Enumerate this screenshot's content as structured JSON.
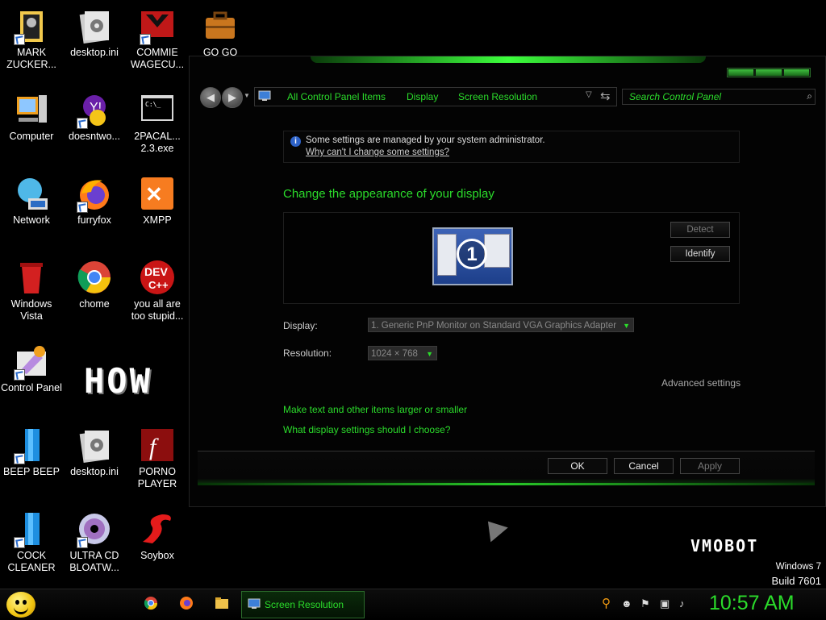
{
  "desktop": {
    "icons": [
      {
        "id": "mark",
        "label": "MARK ZUCKER..."
      },
      {
        "id": "desktopini1",
        "label": "desktop.ini"
      },
      {
        "id": "commie",
        "label": "COMMIE WAGECU..."
      },
      {
        "id": "gogo",
        "label": "GO GO"
      },
      {
        "id": "computer",
        "label": "Computer"
      },
      {
        "id": "doesnt",
        "label": "doesntwo..."
      },
      {
        "id": "pacal",
        "label": "2PACAL... 2.3.exe"
      },
      {
        "id": "network",
        "label": "Network"
      },
      {
        "id": "furryfox",
        "label": "furryfox"
      },
      {
        "id": "xmpp",
        "label": "XMPP"
      },
      {
        "id": "vista",
        "label": "Windows Vista"
      },
      {
        "id": "chome",
        "label": "chome"
      },
      {
        "id": "devcpp",
        "label": "you all are too stupid..."
      },
      {
        "id": "cpanel",
        "label": "Control Panel"
      },
      {
        "id": "beep",
        "label": "BEEP BEEP"
      },
      {
        "id": "desktopini2",
        "label": "desktop.ini"
      },
      {
        "id": "porno",
        "label": "PORNO PLAYER"
      },
      {
        "id": "cock",
        "label": "COCK CLEANER"
      },
      {
        "id": "ultracd",
        "label": "ULTRA CD BLOATW..."
      },
      {
        "id": "soybox",
        "label": "Soybox"
      }
    ],
    "how_text": "HOW",
    "vmobot_text": "VMOBOT",
    "windows_version": "Windows 7",
    "build": "Build 7601"
  },
  "window": {
    "breadcrumb": [
      "All Control Panel Items",
      "Display",
      "Screen Resolution"
    ],
    "search_placeholder": "Search Control Panel",
    "info_line1": "Some settings are managed by your system administrator.",
    "info_link": "Why can't I change some settings?",
    "heading": "Change the appearance of your display",
    "monitor_number": "1",
    "detect_label": "Detect",
    "identify_label": "Identify",
    "display_label": "Display:",
    "display_value": "1. Generic PnP Monitor on Standard VGA Graphics Adapter",
    "resolution_label": "Resolution:",
    "resolution_value": "1024 × 768",
    "advanced_label": "Advanced settings",
    "link1": "Make text and other items larger or smaller",
    "link2": "What display settings should I choose?",
    "ok_label": "OK",
    "cancel_label": "Cancel",
    "apply_label": "Apply"
  },
  "taskbar": {
    "task_label": "Screen Resolution",
    "clock": "10:57 AM"
  },
  "colors": {
    "accent": "#2bdc2b",
    "background": "#000000"
  }
}
